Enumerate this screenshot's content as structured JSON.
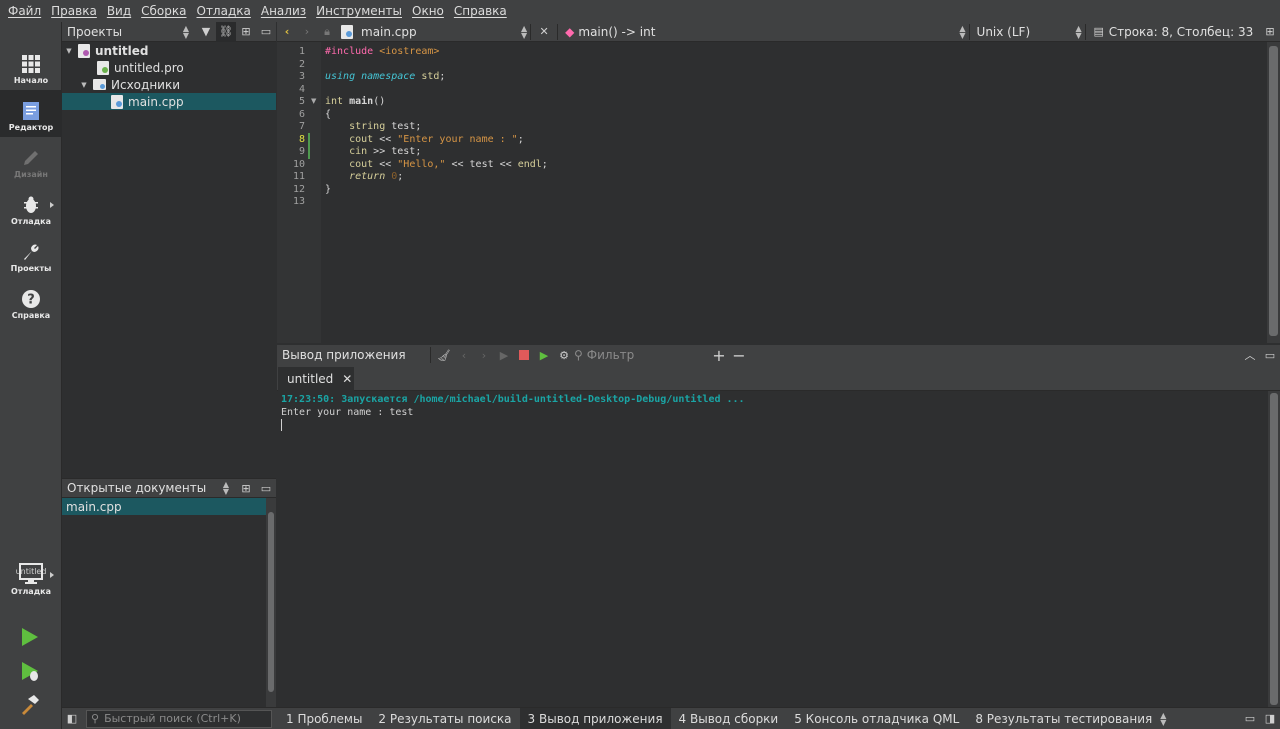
{
  "menu": [
    "Файл",
    "Правка",
    "Вид",
    "Сборка",
    "Отладка",
    "Анализ",
    "Инструменты",
    "Окно",
    "Справка"
  ],
  "modes": [
    {
      "label": "Начало",
      "icon": "grid-icon"
    },
    {
      "label": "Редактор",
      "icon": "editor-icon"
    },
    {
      "label": "Дизайн",
      "icon": "pencil-icon"
    },
    {
      "label": "Отладка",
      "icon": "bug-icon"
    },
    {
      "label": "Проекты",
      "icon": "wrench-icon"
    },
    {
      "label": "Справка",
      "icon": "help-icon"
    }
  ],
  "kit": {
    "project": "untitled",
    "label": "Отладка"
  },
  "projects_panel": {
    "title": "Проекты",
    "tree": [
      "untitled",
      "untitled.pro",
      "Исходники",
      "main.cpp"
    ]
  },
  "open_docs": {
    "title": "Открытые документы",
    "items": [
      "main.cpp"
    ]
  },
  "editor_toolbar": {
    "file": "main.cpp",
    "symbol": "main() -> int",
    "line_ending": "Unix (LF)",
    "position": "Строка: 8, Столбец: 33"
  },
  "code": {
    "line_numbers": [
      "1",
      "2",
      "3",
      "4",
      "5",
      "6",
      "7",
      "8",
      "9",
      "10",
      "11",
      "12",
      "13"
    ],
    "current_line": 8
  },
  "output_pane": {
    "title": "Вывод приложения",
    "filter_placeholder": "Фильтр",
    "tab": "untitled",
    "lines": [
      "17:23:50: Запускается /home/michael/build-untitled-Desktop-Debug/untitled ...",
      "Enter your name : test"
    ]
  },
  "statusbar": {
    "locator_placeholder": "Быстрый поиск (Ctrl+K)",
    "tabs": [
      "1  Проблемы",
      "2  Результаты поиска",
      "3  Вывод приложения",
      "4  Вывод сборки",
      "5  Консоль отладчика QML",
      "8  Результаты тестирования"
    ]
  },
  "colors": {
    "accent": "#1c5860",
    "run": "#5fbf3f",
    "stop": "#e05a5a",
    "output_system": "#1aa5a5"
  }
}
